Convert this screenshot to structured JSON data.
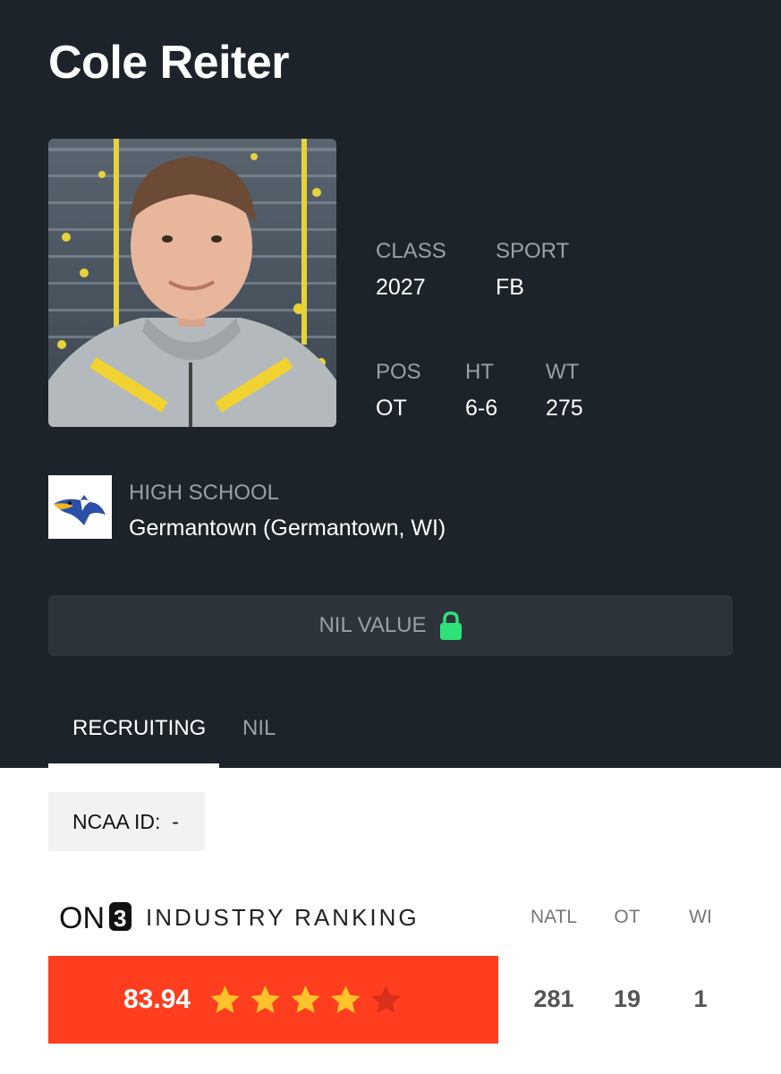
{
  "player": {
    "name": "Cole Reiter"
  },
  "stats": {
    "class_label": "CLASS",
    "class_value": "2027",
    "sport_label": "SPORT",
    "sport_value": "FB",
    "pos_label": "POS",
    "pos_value": "OT",
    "ht_label": "HT",
    "ht_value": "6-6",
    "wt_label": "WT",
    "wt_value": "275"
  },
  "school": {
    "label": "HIGH SCHOOL",
    "value": "Germantown (Germantown, WI)",
    "logo_icon": "eagle-mascot-icon"
  },
  "nil": {
    "label": "NIL VALUE",
    "icon": "lock-icon",
    "icon_color": "#2ee27a"
  },
  "tabs": [
    {
      "label": "RECRUITING",
      "active": true
    },
    {
      "label": "NIL",
      "active": false
    }
  ],
  "ncaa": {
    "label": "NCAA ID:",
    "value": "-"
  },
  "ranking": {
    "title": "INDUSTRY RANKING",
    "brand": "ON3",
    "rating": "83.94",
    "stars_filled": 4,
    "stars_total": 5,
    "columns": [
      {
        "label": "NATL",
        "value": "281"
      },
      {
        "label": "OT",
        "value": "19"
      },
      {
        "label": "WI",
        "value": "1"
      }
    ]
  },
  "colors": {
    "hero_bg": "#1d232a",
    "rating_bg": "#ff3d1f",
    "star_filled": "#ffc22a",
    "star_empty": "#d8301a"
  }
}
